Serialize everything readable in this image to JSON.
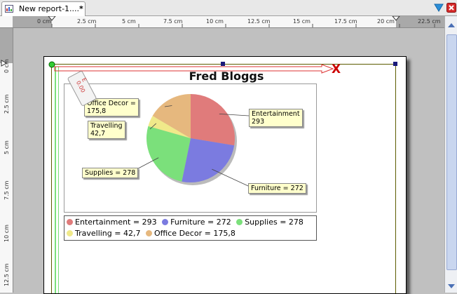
{
  "tab": {
    "label": "New report-1....",
    "dirty": "*"
  },
  "toolbar": {
    "menu_icon": "triangle-down-icon",
    "close_icon": "close-red-icon"
  },
  "ruler_h": {
    "labels": [
      "0 cm",
      "2.5 cm",
      "5 cm",
      "7.5 cm",
      "10 cm",
      "12.5 cm",
      "15 cm",
      "17.5 cm",
      "20 cm",
      "22.5 cm"
    ]
  },
  "ruler_v": {
    "labels": [
      "0 cm",
      "2.5 cm",
      "5 cm",
      "7.5 cm",
      "10 cm",
      "12.5 cm"
    ]
  },
  "report": {
    "title": "Fred Bloggs",
    "marker_x": "X",
    "tag_text": "E 0.00"
  },
  "callouts": {
    "office": [
      "Office Decor =",
      "175,8"
    ],
    "travelling": [
      "Travelling",
      "42,7"
    ],
    "supplies": "Supplies = 278",
    "entertainment": [
      "Entertainment",
      "293"
    ],
    "furniture": "Furniture = 272"
  },
  "legend": {
    "row1": [
      "Entertainment = 293",
      "Furniture = 272",
      "Supplies = 278"
    ],
    "row2": [
      "Travelling = 42,7",
      "Office Decor = 175,8"
    ]
  },
  "chart_data": {
    "type": "pie",
    "categories": [
      "Entertainment",
      "Furniture",
      "Supplies",
      "Travelling",
      "Office Decor"
    ],
    "values": [
      293,
      272,
      278,
      42.7,
      175.8
    ],
    "colors": [
      "#e07b7b",
      "#7b7be0",
      "#7be07b",
      "#f0e98a",
      "#e6b87e"
    ],
    "title": "Fred Bloggs",
    "legend_position": "bottom"
  }
}
